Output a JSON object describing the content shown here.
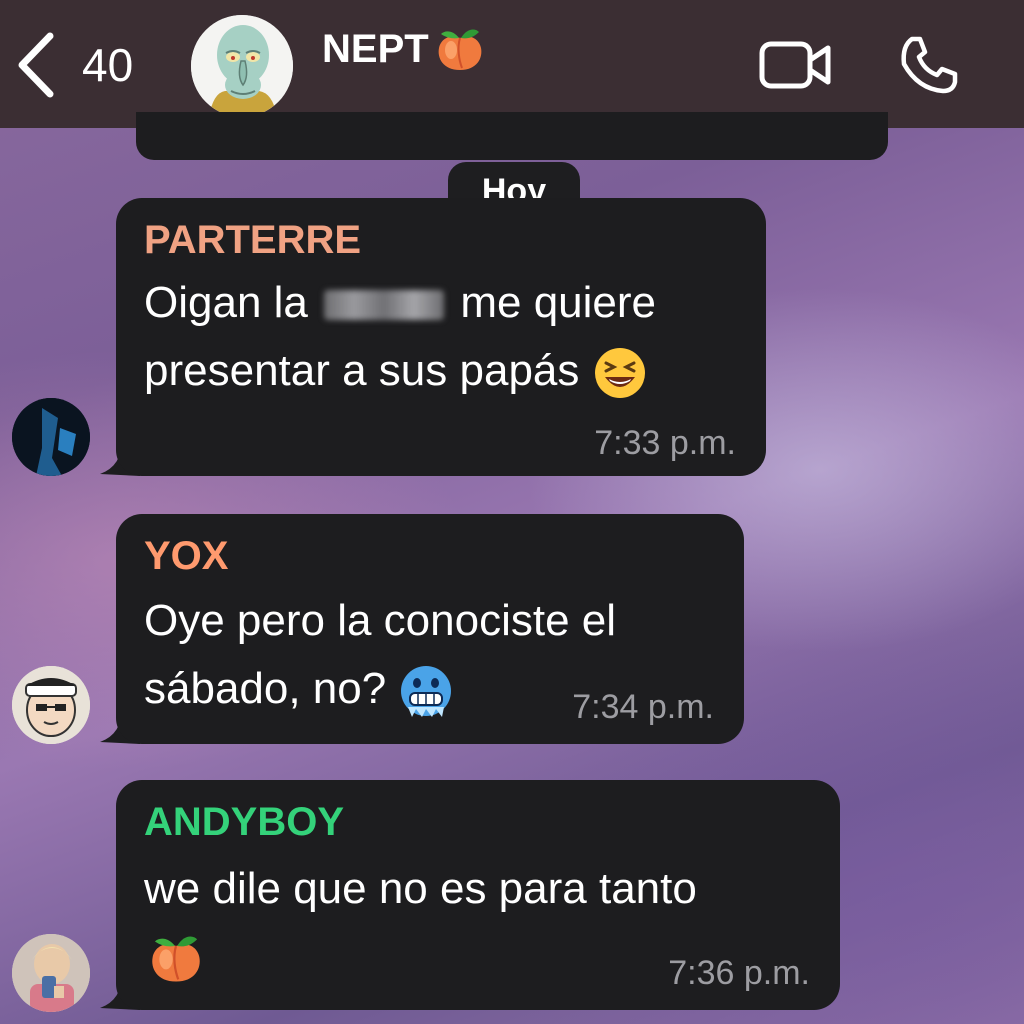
{
  "header": {
    "back_count": "40",
    "title": "NEPT",
    "title_emoji": "peach"
  },
  "date_chip": "Hoy",
  "messages": [
    {
      "sender": "PARTERRE",
      "sender_color": "#f0a283",
      "line1_a": "Oigan la",
      "line1_b": "me quiere",
      "line2": "presentar a sus papás",
      "emoji": "laughing-face",
      "time": "7:33 p.m."
    },
    {
      "sender": "YOX",
      "sender_color": "#ff9a6e",
      "line1": "Oye pero la conociste el",
      "line2": "sábado, no?",
      "emoji": "cold-face",
      "time": "7:34 p.m."
    },
    {
      "sender": "ANDYBOY",
      "sender_color": "#34d27a",
      "line1": "we dile que no es para tanto",
      "emoji": "peach",
      "time": "7:36 p.m."
    }
  ]
}
